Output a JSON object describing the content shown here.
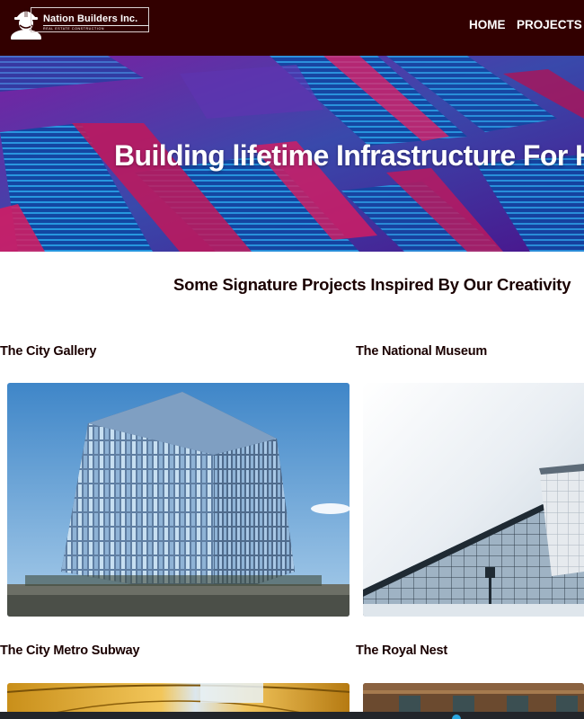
{
  "brand": {
    "name": "Nation Builders Inc.",
    "tagline": "REAL ESTATE CONSTRUCTION",
    "logo_icon": "hardhat-worker-icon"
  },
  "nav": {
    "home": "HOME",
    "projects": "PROJECTS"
  },
  "hero": {
    "title": "Building lifetime Infrastructure For Hur"
  },
  "projects_section": {
    "heading": "Some Signature Projects Inspired By Our Creativity",
    "items": [
      {
        "title": "The City Gallery"
      },
      {
        "title": "The National Museum"
      },
      {
        "title": "The City Metro Subway"
      },
      {
        "title": "The Royal Nest"
      }
    ]
  },
  "colors": {
    "navbar": "#320000",
    "heading_text": "#1a0000",
    "hero_accent": "#c2185b",
    "hero_glass": "#1e88e5"
  }
}
